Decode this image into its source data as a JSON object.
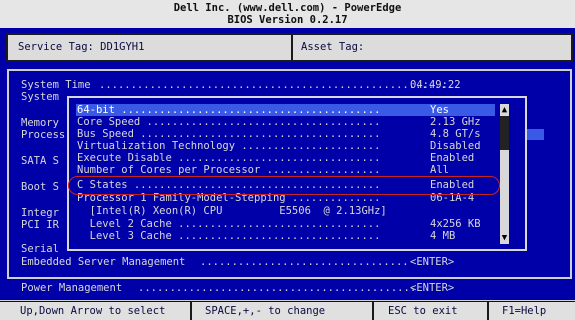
{
  "header": {
    "line1": "Dell Inc. (www.dell.com) - PowerEdge",
    "line2": "BIOS Version 0.2.17"
  },
  "tags": {
    "service_tag": "Service Tag: DD1GYH1",
    "asset_tag": "Asset Tag:"
  },
  "main": {
    "system_time_label": "System Time",
    "system_time_dots": "........................................................",
    "system_time_value": "04:49:22",
    "items": [
      "System",
      "Memory",
      "Process",
      "SATA S",
      "Boot S",
      "Integr",
      "PCI IR",
      "Serial"
    ],
    "embedded": {
      "label": "Embedded Server Management",
      "dots": ".................................",
      "value": "<ENTER>"
    },
    "power": {
      "label": "Power Management",
      "dots": "............................................",
      "value": "<ENTER>"
    }
  },
  "popup": {
    "rows": [
      {
        "label": "64-bit .........................................",
        "value": "Yes"
      },
      {
        "label": "Core Speed .....................................",
        "value": "2.13 GHz"
      },
      {
        "label": "Bus Speed ......................................",
        "value": "4.8 GT/s"
      },
      {
        "label": "Virtualization Technology ......................",
        "value": "Disabled"
      },
      {
        "label": "Execute Disable ................................",
        "value": "Enabled"
      },
      {
        "label": "Number of Cores per Processor ..................",
        "value": "All"
      },
      {
        "label": "C States .......................................",
        "value": "Enabled"
      },
      {
        "label": "Processor 1 Family-Model-Stepping ..............",
        "value": "06-1A-4"
      },
      {
        "label": "  [Intel(R) Xeon(R) CPU         E5506  @ 2.13GHz]",
        "value": ""
      },
      {
        "label": "  Level 2 Cache ................................",
        "value": "4x256 KB"
      },
      {
        "label": "  Level 3 Cache ................................",
        "value": "4 MB"
      }
    ],
    "scroll_up": "▲",
    "scroll_down": "▼"
  },
  "footer": {
    "nav": "Up,Down Arrow to select",
    "change": "SPACE,+,- to change",
    "exit": "ESC to exit",
    "help": "F1=Help"
  },
  "colors": {
    "background": "#0000a8",
    "highlight": "#3a5ae6",
    "text": "#d8d8d8",
    "header_bg": "#e6e6e6",
    "annotation_ring": "#cc2222"
  }
}
